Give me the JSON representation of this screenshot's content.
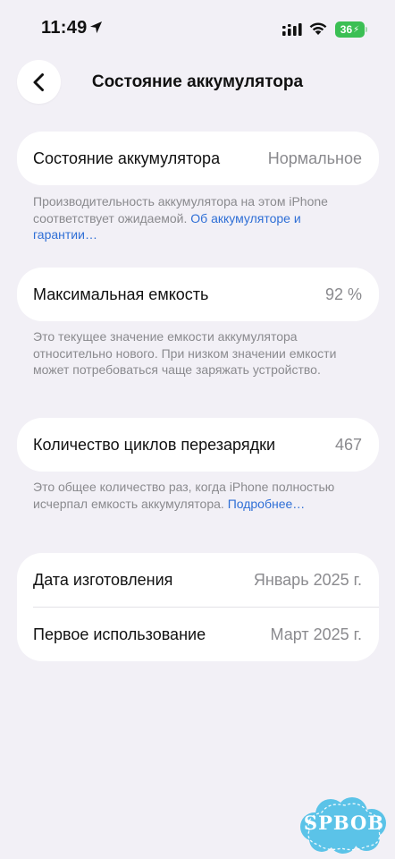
{
  "status_bar": {
    "time": "11:49",
    "battery_level": "36",
    "battery_color": "#3bbf54"
  },
  "nav": {
    "back_icon": "chevron-left-icon",
    "title": "Состояние аккумулятора"
  },
  "sections": {
    "health": {
      "label": "Состояние аккумулятора",
      "value": "Нормальное",
      "footnote_text": "Производительность аккумулятора на этом iPhone соответствует ожидаемой. ",
      "footnote_link": "Об аккумуляторе и гарантии…"
    },
    "capacity": {
      "label": "Максимальная емкость",
      "value": "92 %",
      "footnote_text": "Это текущее значение емкости аккумулятора относительно нового. При низком значении емкости может потребоваться чаще заряжать устройство."
    },
    "cycles": {
      "label": "Количество циклов перезарядки",
      "value": "467",
      "footnote_text": "Это общее количество раз, когда iPhone полностью исчерпал емкость аккумулятора. ",
      "footnote_link": "Подробнее…"
    },
    "dates": {
      "manufacture_label": "Дата изготовления",
      "manufacture_value": "Январь 2025 г.",
      "first_use_label": "Первое использование",
      "first_use_value": "Март 2025 г."
    }
  },
  "watermark": {
    "text": "SPBOB",
    "color": "#5bc3e8"
  },
  "colors": {
    "background": "#f2f0f6",
    "card": "#ffffff",
    "link": "#2f6fd6",
    "secondary_text": "#8a8a8e"
  }
}
